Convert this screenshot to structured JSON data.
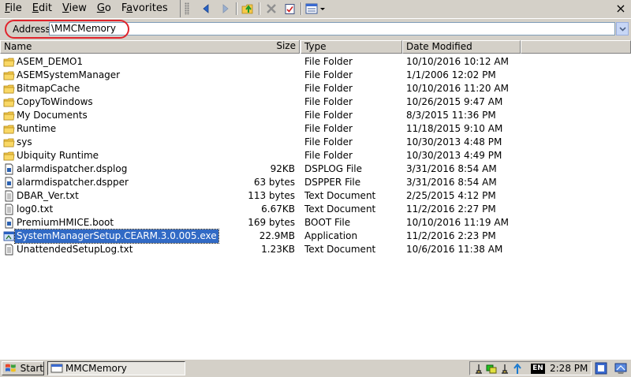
{
  "menu": {
    "items": [
      {
        "label": "File",
        "key": "F"
      },
      {
        "label": "Edit",
        "key": "E"
      },
      {
        "label": "View",
        "key": "V"
      },
      {
        "label": "Go",
        "key": "G"
      },
      {
        "label": "Favorites",
        "key": "a"
      }
    ]
  },
  "toolbar": {
    "close_label": "×",
    "icons": [
      "back-icon",
      "forward-icon",
      "up-folder-icon",
      "delete-icon",
      "properties-icon",
      "views-icon"
    ]
  },
  "address": {
    "label": "Address",
    "value": "\\MMCMemory"
  },
  "columns": {
    "name": "Name",
    "size": "Size",
    "type": "Type",
    "date": "Date Modified"
  },
  "files": [
    {
      "name": "ASEM_DEMO1",
      "size": "",
      "type": "File Folder",
      "date": "10/10/2016 10:12 AM",
      "icon": "folder-icon"
    },
    {
      "name": "ASEMSystemManager",
      "size": "",
      "type": "File Folder",
      "date": "1/1/2006 12:02 PM",
      "icon": "folder-icon"
    },
    {
      "name": "BitmapCache",
      "size": "",
      "type": "File Folder",
      "date": "10/10/2016 11:20 AM",
      "icon": "folder-icon"
    },
    {
      "name": "CopyToWindows",
      "size": "",
      "type": "File Folder",
      "date": "10/26/2015 9:47 AM",
      "icon": "folder-icon"
    },
    {
      "name": "My Documents",
      "size": "",
      "type": "File Folder",
      "date": "8/3/2015 11:36 PM",
      "icon": "folder-icon"
    },
    {
      "name": "Runtime",
      "size": "",
      "type": "File Folder",
      "date": "11/18/2015 9:10 AM",
      "icon": "folder-icon"
    },
    {
      "name": "sys",
      "size": "",
      "type": "File Folder",
      "date": "10/30/2013 4:48 PM",
      "icon": "folder-icon"
    },
    {
      "name": "Ubiquity Runtime",
      "size": "",
      "type": "File Folder",
      "date": "10/30/2013 4:49 PM",
      "icon": "folder-icon"
    },
    {
      "name": "alarmdispatcher.dsplog",
      "size": "92KB",
      "type": "DSPLOG File",
      "date": "3/31/2016 8:54 AM",
      "icon": "generic-file-icon"
    },
    {
      "name": "alarmdispatcher.dspper",
      "size": "63 bytes",
      "type": "DSPPER File",
      "date": "3/31/2016 8:54 AM",
      "icon": "generic-file-icon"
    },
    {
      "name": "DBAR_Ver.txt",
      "size": "113 bytes",
      "type": "Text Document",
      "date": "2/25/2015 4:12 PM",
      "icon": "text-file-icon"
    },
    {
      "name": "log0.txt",
      "size": "6.67KB",
      "type": "Text Document",
      "date": "11/2/2016 2:27 PM",
      "icon": "text-file-icon"
    },
    {
      "name": "PremiumHMICE.boot",
      "size": "169 bytes",
      "type": "BOOT File",
      "date": "10/10/2016 11:19 AM",
      "icon": "generic-file-icon"
    },
    {
      "name": "SystemManagerSetup.CEARM.3.0.005.exe",
      "size": "22.9MB",
      "type": "Application",
      "date": "11/2/2016 2:23 PM",
      "icon": "application-icon",
      "selected": true
    },
    {
      "name": "UnattendedSetupLog.txt",
      "size": "1.23KB",
      "type": "Text Document",
      "date": "10/6/2016 11:38 AM",
      "icon": "text-file-icon"
    }
  ],
  "taskbar": {
    "start_label": "Start",
    "task_label": "MMCMemory",
    "language": "EN",
    "clock": "2:28 PM"
  },
  "colors": {
    "selection": "#316ac5",
    "highlight_ring": "#e0242c",
    "folder": "#f5c94a"
  }
}
